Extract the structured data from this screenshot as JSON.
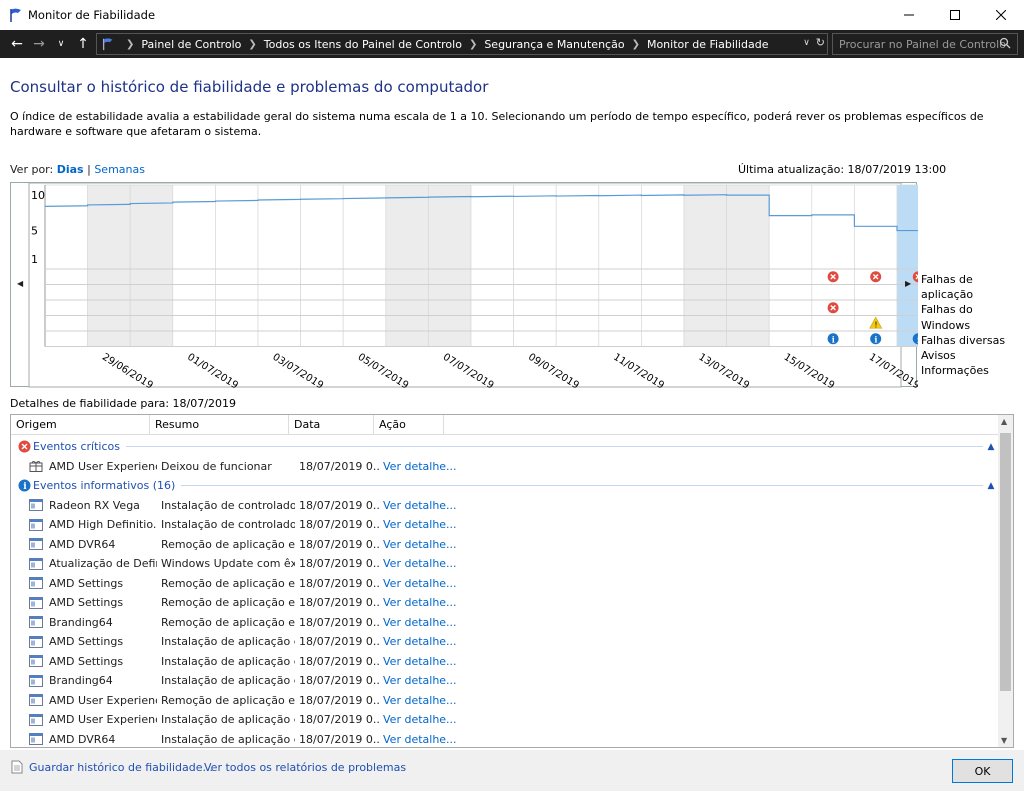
{
  "window": {
    "title": "Monitor de Fiabilidade",
    "minimize_icon": "minimize-icon",
    "maximize_icon": "maximize-icon",
    "close_icon": "close-icon"
  },
  "address": {
    "crumbs": [
      "Painel de Controlo",
      "Todos os Itens do Painel de Controlo",
      "Segurança e Manutenção",
      "Monitor de Fiabilidade"
    ],
    "search_placeholder": "Procurar no Painel de Controlo"
  },
  "heading": "Consultar o histórico de fiabilidade e problemas do computador",
  "description": "O índice de estabilidade avalia a estabilidade geral do sistema numa escala de 1 a 10. Selecionando um período de tempo específico, poderá rever os problemas específicos de hardware e software que afetaram o sistema.",
  "view_by": {
    "label": "Ver por:",
    "days": "Dias",
    "separator": "|",
    "weeks": "Semanas"
  },
  "last_update": "Última atualização: 18/07/2019 13:00",
  "chart_data": {
    "type": "line",
    "yticks": [
      "10",
      "5",
      "1"
    ],
    "ylim": [
      1,
      10
    ],
    "x": [
      "28/06/2019",
      "29/06/2019",
      "30/06/2019",
      "01/07/2019",
      "02/07/2019",
      "03/07/2019",
      "04/07/2019",
      "05/07/2019",
      "06/07/2019",
      "07/07/2019",
      "08/07/2019",
      "09/07/2019",
      "10/07/2019",
      "11/07/2019",
      "12/07/2019",
      "13/07/2019",
      "14/07/2019",
      "15/07/2019",
      "16/07/2019",
      "17/07/2019",
      "18/07/2019"
    ],
    "xtick_labels": [
      "29/06/2019",
      "01/07/2019",
      "03/07/2019",
      "05/07/2019",
      "07/07/2019",
      "09/07/2019",
      "11/07/2019",
      "13/07/2019",
      "15/07/2019",
      "17/07/2019"
    ],
    "stability_index": [
      8.4,
      8.6,
      8.8,
      9.0,
      9.15,
      9.3,
      9.4,
      9.5,
      9.6,
      9.7,
      9.75,
      9.8,
      9.85,
      9.9,
      9.93,
      9.96,
      9.98,
      7.1,
      7.2,
      5.6,
      5.0
    ],
    "selected_day": "18/07/2019",
    "weekend_days": [
      "29/06/2019",
      "30/06/2019",
      "06/07/2019",
      "07/07/2019",
      "13/07/2019",
      "14/07/2019"
    ],
    "categories": [
      "Falhas de aplicação",
      "Falhas do Windows",
      "Falhas diversas",
      "Avisos",
      "Informações"
    ],
    "events": [
      {
        "date": "16/07/2019",
        "category": "Falhas de aplicação",
        "icon": "error-icon"
      },
      {
        "date": "17/07/2019",
        "category": "Falhas de aplicação",
        "icon": "error-icon"
      },
      {
        "date": "18/07/2019",
        "category": "Falhas de aplicação",
        "icon": "error-icon"
      },
      {
        "date": "16/07/2019",
        "category": "Falhas diversas",
        "icon": "error-icon"
      },
      {
        "date": "17/07/2019",
        "category": "Avisos",
        "icon": "warning-icon"
      },
      {
        "date": "16/07/2019",
        "category": "Informações",
        "icon": "info-icon"
      },
      {
        "date": "17/07/2019",
        "category": "Informações",
        "icon": "info-icon"
      },
      {
        "date": "18/07/2019",
        "category": "Informações",
        "icon": "info-icon"
      },
      {
        "date": "18/07/2019",
        "category": "Informações",
        "icon": "info-icon"
      }
    ]
  },
  "details": {
    "title": "Detalhes de fiabilidade para: 18/07/2019",
    "columns": [
      "Origem",
      "Resumo",
      "Data",
      "Ação"
    ],
    "groups": [
      {
        "label": "Eventos críticos",
        "icon": "error-icon",
        "rows": [
          {
            "origem": "AMD User Experienc...",
            "resumo": "Deixou de funcionar",
            "data": "18/07/2019 0...",
            "acao": "Ver detalhe..."
          }
        ]
      },
      {
        "label": "Eventos informativos (16)",
        "icon": "info-icon",
        "rows": [
          {
            "origem": "Radeon RX Vega",
            "resumo": "Instalação de controlador...",
            "data": "18/07/2019 0...",
            "acao": "Ver detalhe..."
          },
          {
            "origem": "AMD High Definitio...",
            "resumo": "Instalação de controlador...",
            "data": "18/07/2019 0...",
            "acao": "Ver detalhe..."
          },
          {
            "origem": "AMD DVR64",
            "resumo": "Remoção de aplicação efe...",
            "data": "18/07/2019 0...",
            "acao": "Ver detalhe..."
          },
          {
            "origem": "Atualização de Defin...",
            "resumo": "Windows Update com êxi...",
            "data": "18/07/2019 0...",
            "acao": "Ver detalhe..."
          },
          {
            "origem": "AMD Settings",
            "resumo": "Remoção de aplicação efe...",
            "data": "18/07/2019 0...",
            "acao": "Ver detalhe..."
          },
          {
            "origem": "AMD Settings",
            "resumo": "Remoção de aplicação efe...",
            "data": "18/07/2019 0...",
            "acao": "Ver detalhe..."
          },
          {
            "origem": "Branding64",
            "resumo": "Remoção de aplicação efe...",
            "data": "18/07/2019 0...",
            "acao": "Ver detalhe..."
          },
          {
            "origem": "AMD Settings",
            "resumo": "Instalação de aplicação ef...",
            "data": "18/07/2019 0...",
            "acao": "Ver detalhe..."
          },
          {
            "origem": "AMD Settings",
            "resumo": "Instalação de aplicação ef...",
            "data": "18/07/2019 0...",
            "acao": "Ver detalhe..."
          },
          {
            "origem": "Branding64",
            "resumo": "Instalação de aplicação ef...",
            "data": "18/07/2019 0...",
            "acao": "Ver detalhe..."
          },
          {
            "origem": "AMD User Experienc...",
            "resumo": "Remoção de aplicação efe...",
            "data": "18/07/2019 0...",
            "acao": "Ver detalhe..."
          },
          {
            "origem": "AMD User Experienc...",
            "resumo": "Instalação de aplicação ef...",
            "data": "18/07/2019 0...",
            "acao": "Ver detalhe..."
          },
          {
            "origem": "AMD DVR64",
            "resumo": "Instalação de aplicação ef...",
            "data": "18/07/2019 0...",
            "acao": "Ver detalhe..."
          }
        ]
      }
    ]
  },
  "footer": {
    "save_link": "Guardar histórico de fiabilidade...",
    "view_all_link": "Ver todos os relatórios de problemas",
    "ok": "OK"
  },
  "colors": {
    "accent": "#0078d7",
    "line": "#5b9bd5",
    "selected": "#bcdcf5",
    "weekend": "#ececec",
    "error": "#e04a3f",
    "info": "#1a73c8",
    "warning": "#f2c811"
  }
}
